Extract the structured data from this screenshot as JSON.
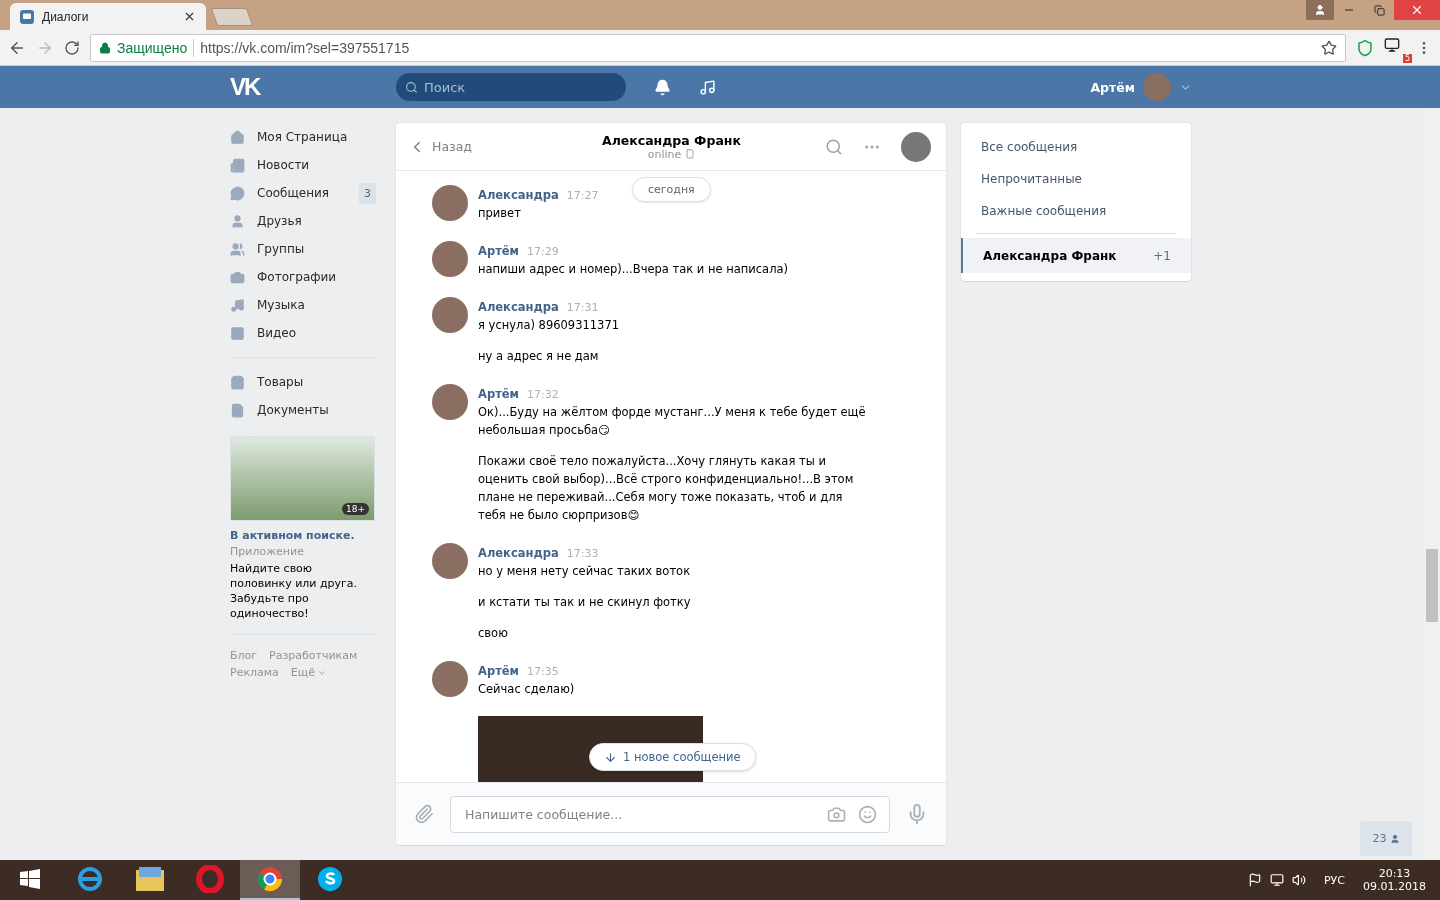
{
  "browser": {
    "tab": {
      "title": "Диалоги"
    },
    "secure_label": "Защищено",
    "url": "https://vk.com/im?sel=397551715",
    "extension_badge": "5"
  },
  "header": {
    "logo": "VK",
    "search": {
      "placeholder": "Поиск"
    },
    "user_name": "Артём"
  },
  "sidebar": {
    "items": [
      {
        "label": "Моя Страница"
      },
      {
        "label": "Новости"
      },
      {
        "label": "Сообщения",
        "badge": "3"
      },
      {
        "label": "Друзья"
      },
      {
        "label": "Группы"
      },
      {
        "label": "Фотографии"
      },
      {
        "label": "Музыка"
      },
      {
        "label": "Видео"
      }
    ],
    "extra_items": [
      {
        "label": "Товары"
      },
      {
        "label": "Документы"
      }
    ],
    "ad": {
      "badge": "18+",
      "title": "В активном поиске.",
      "subtitle": "Приложение",
      "text": "Найдите свою половинку или друга. Забудьте про одиночество!"
    },
    "footer_links": [
      "Блог",
      "Разработчикам",
      "Реклама",
      "Ещё"
    ]
  },
  "chat": {
    "back": "Назад",
    "title": "Александра Франк",
    "status": "online",
    "date_pill": "сегодня",
    "groups": [
      {
        "sender": "Александра",
        "time": "17:27",
        "messages": [
          {
            "kind": "text",
            "text": "привет"
          }
        ]
      },
      {
        "sender": "Артём",
        "time": "17:29",
        "messages": [
          {
            "kind": "text",
            "text": "напиши адрес и номер)...Вчера так и не написала)"
          }
        ]
      },
      {
        "sender": "Александра",
        "time": "17:31",
        "messages": [
          {
            "kind": "text",
            "text": "я уснула) 89609311371"
          },
          {
            "kind": "text",
            "text": "ну а адрес я не дам"
          }
        ]
      },
      {
        "sender": "Артём",
        "time": "17:32",
        "messages": [
          {
            "kind": "text",
            "text": "Ок)...Буду на жёлтом форде мустанг...У меня к тебе будет ещё небольшая просьба😏"
          },
          {
            "kind": "text",
            "text": "Покажи своё тело пожалуйста...Хочу глянуть какая ты и оценить свой выбор)...Всё строго конфиденциально!...В этом плане не переживай...Себя могу тоже показать, чтоб и для тебя не было сюрпризов😊"
          }
        ]
      },
      {
        "sender": "Александра",
        "time": "17:33",
        "messages": [
          {
            "kind": "text",
            "text": "но у меня нету сейчас таких воток"
          },
          {
            "kind": "text",
            "text": "и кстати ты так и не скинул фотку"
          },
          {
            "kind": "text",
            "text": "свою"
          }
        ]
      },
      {
        "sender": "Артём",
        "time": "17:35",
        "messages": [
          {
            "kind": "text",
            "text": "Сейчас сделаю)"
          },
          {
            "kind": "photo"
          }
        ]
      }
    ],
    "new_messages": "1 новое сообщение",
    "input": {
      "placeholder": "Напишите сообщение..."
    }
  },
  "filters": {
    "items": [
      {
        "label": "Все сообщения"
      },
      {
        "label": "Непрочитанные"
      },
      {
        "label": "Важные сообщения"
      }
    ],
    "conversations": [
      {
        "name": "Александра Франк",
        "count": "+1",
        "selected": true
      }
    ]
  },
  "online_counter": "23",
  "taskbar": {
    "apps": [
      {
        "kind": "ie",
        "active": false
      },
      {
        "kind": "explorer",
        "active": false
      },
      {
        "kind": "opera",
        "active": false
      },
      {
        "kind": "chrome",
        "active": true
      },
      {
        "kind": "skype",
        "active": false
      }
    ],
    "language": "РУС",
    "time": "20:13",
    "date": "09.01.2018"
  }
}
